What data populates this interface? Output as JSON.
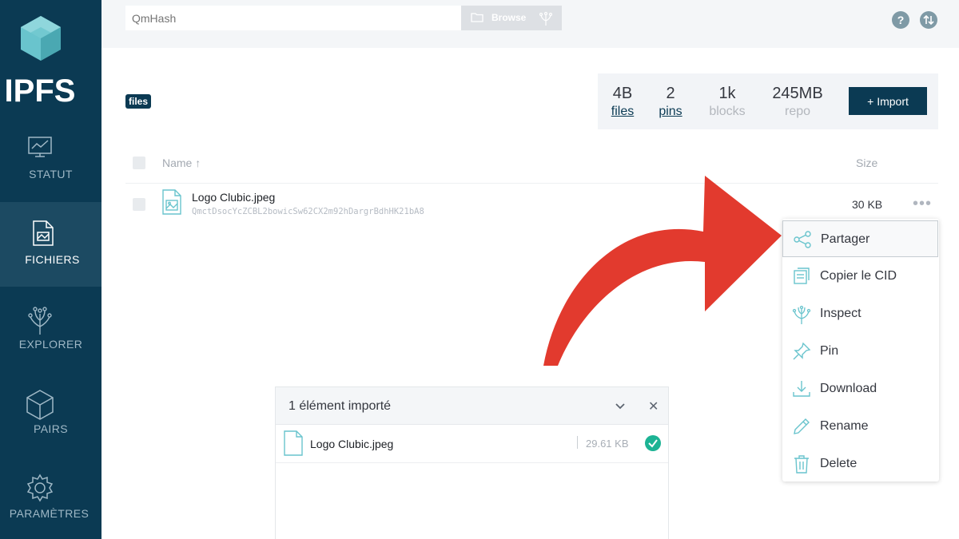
{
  "sidebar": {
    "logo_text": "IPFS",
    "items": [
      {
        "label": "STATUT",
        "icon": "status-chart-icon"
      },
      {
        "label": "FICHIERS",
        "icon": "files-icon"
      },
      {
        "label": "EXPLORER",
        "icon": "explorer-tree-icon"
      },
      {
        "label": "PAIRS",
        "icon": "peers-cube-icon"
      },
      {
        "label": "PARAMÈTRES",
        "icon": "settings-gear-icon"
      }
    ]
  },
  "topbar": {
    "hash_placeholder": "QmHash",
    "browse_label": "Browse"
  },
  "breadcrumb": {
    "label": "files"
  },
  "stats": {
    "files": {
      "value": "4B",
      "label": "files"
    },
    "pins": {
      "value": "2",
      "label": "pins"
    },
    "blocks": {
      "value": "1k",
      "label": "blocks"
    },
    "repo": {
      "value": "245MB",
      "label": "repo"
    }
  },
  "import_button": "+ Import",
  "table": {
    "name_header": "Name ↑",
    "size_header": "Size",
    "rows": [
      {
        "name": "Logo Clubic.jpeg",
        "hash": "QmctDsocYcZCBL2bowicSw62CX2m92hDargrBdhHK21bA8",
        "size": "30 KB"
      }
    ]
  },
  "context_menu": {
    "items": [
      {
        "label": "Partager",
        "icon": "share-icon"
      },
      {
        "label": "Copier le CID",
        "icon": "copy-icon"
      },
      {
        "label": "Inspect",
        "icon": "inspect-tree-icon"
      },
      {
        "label": "Pin",
        "icon": "pin-icon"
      },
      {
        "label": "Download",
        "icon": "download-icon"
      },
      {
        "label": "Rename",
        "icon": "pencil-icon"
      },
      {
        "label": "Delete",
        "icon": "trash-icon"
      }
    ]
  },
  "import_panel": {
    "title": "1 élément importé",
    "close": "✕",
    "files": [
      {
        "name": "Logo Clubic.jpeg",
        "size": "29.61 KB"
      }
    ]
  },
  "colors": {
    "sidebar": "#0b3a53",
    "accent_teal": "#69c4cd",
    "success": "#1cb394",
    "arrow": "#e23a2e"
  }
}
